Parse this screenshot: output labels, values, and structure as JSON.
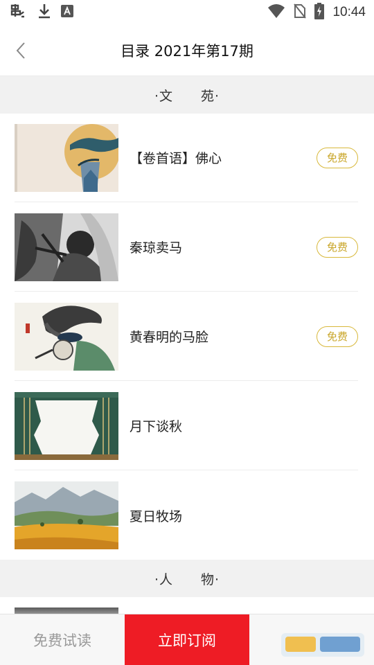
{
  "status_bar": {
    "time": "10:44",
    "icons": [
      "bug-icon",
      "download-icon",
      "a-notification-icon",
      "wifi-icon",
      "no-sim-icon",
      "battery-charging-icon"
    ]
  },
  "header": {
    "back_icon": "chevron-left-icon",
    "title": "目录 2021年第17期"
  },
  "sections": [
    {
      "title": "·文　　苑·",
      "articles": [
        {
          "title": "【卷首语】佛心",
          "badge": "免费"
        },
        {
          "title": "秦琼卖马",
          "badge": "免费"
        },
        {
          "title": "黄春明的马脸",
          "badge": "免费"
        },
        {
          "title": "月下谈秋",
          "badge": ""
        },
        {
          "title": "夏日牧场",
          "badge": ""
        }
      ]
    },
    {
      "title": "·人　　物·",
      "articles": []
    }
  ],
  "bottom_bar": {
    "trial_label": "免费试读",
    "subscribe_label": "立即订阅"
  },
  "colors": {
    "accent_red": "#ee1c25",
    "badge_gold": "#c9a62a",
    "section_bg": "#f1f1f1"
  }
}
